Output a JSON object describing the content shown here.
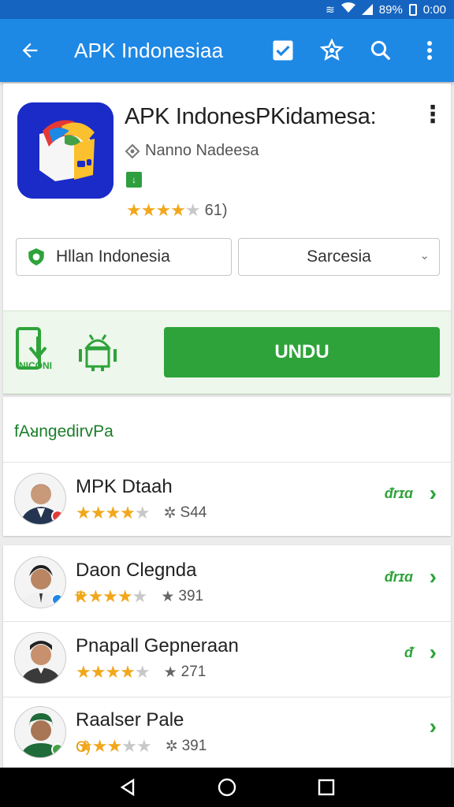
{
  "status_bar": {
    "battery_percent": "89%",
    "time": "0:00"
  },
  "app_bar": {
    "title": "APK Indonesiaa"
  },
  "app": {
    "name": "APK IndonesPKidamesa:",
    "developer": "Nanno Nadeesa",
    "rating_stars": 3.5,
    "rating_count": "61)",
    "buttons": {
      "left_label": "Hllan  Indonesia",
      "right_label": "Sarcesia"
    }
  },
  "download": {
    "icon_caption": "NICONI",
    "button_label": "UNDU"
  },
  "section": {
    "title": "fAᴚngedirvPa"
  },
  "reviews": [
    {
      "name": "MPK Dtaah",
      "prefix": "",
      "stars": 4,
      "count": "S44",
      "count_icon": "✲",
      "label": "ᵭrɪɑ",
      "avatar_color": "#243552",
      "dot_color": "#e53935"
    },
    {
      "name": "Daon Clegnda",
      "prefix": "R",
      "stars": 4,
      "count": "391",
      "count_icon": "★",
      "label": "ᵭrɪɑ",
      "avatar_color": "#3b3b3b",
      "dot_color": "#1e88e5"
    },
    {
      "name": "Pnapall Gepneraan",
      "prefix": "",
      "stars": 4,
      "count": "271",
      "count_icon": "★",
      "label": "ᵭ",
      "avatar_color": "#2b2b2b",
      "dot_color": ""
    },
    {
      "name": "Raalser Pale",
      "prefix": "C)",
      "stars": 3,
      "count": "391",
      "count_icon": "✲",
      "label": "",
      "avatar_color": "#1f6b3a",
      "dot_color": "#43a047"
    }
  ]
}
